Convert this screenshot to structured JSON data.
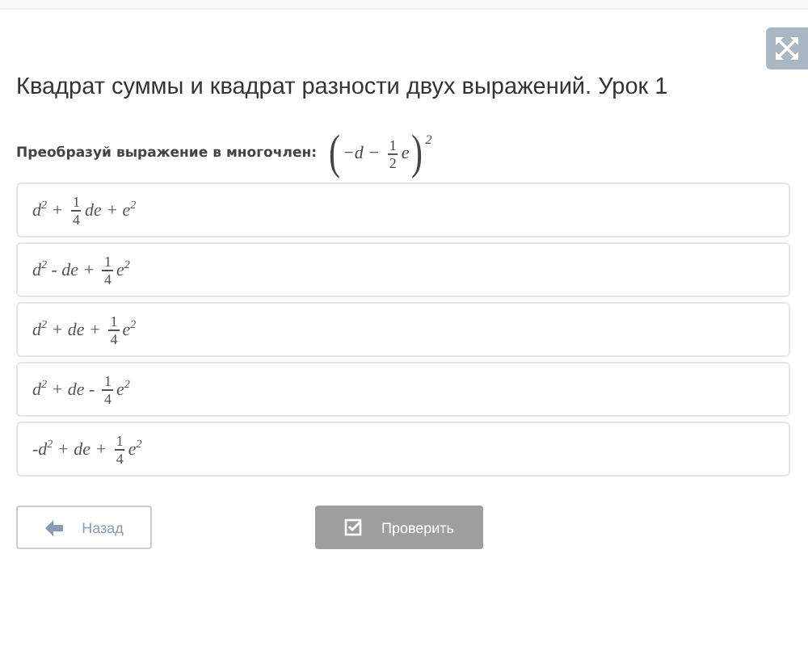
{
  "expand_button": {
    "kind": "expand"
  },
  "title": "Квадрат суммы и квадрат разности двух выражений. Урок 1",
  "question": {
    "label": "Преобразуй выражение в многочлен:",
    "expression": [
      {
        "kind": "paren",
        "t": "("
      },
      {
        "kind": "text",
        "t": "−d − "
      },
      {
        "kind": "frac",
        "num": "1",
        "den": "2"
      },
      {
        "kind": "text",
        "t": "e"
      },
      {
        "kind": "paren",
        "t": ")"
      },
      {
        "kind": "sup",
        "t": "2"
      }
    ]
  },
  "options": [
    {
      "selected": false,
      "parts": [
        {
          "kind": "text",
          "t": "d$^{2}$ + "
        },
        {
          "kind": "frac",
          "num": "1",
          "den": "4"
        },
        {
          "kind": "text",
          "t": "de + e$^{2}$"
        }
      ]
    },
    {
      "selected": false,
      "parts": [
        {
          "kind": "text",
          "t": "d$^{2}$ - de + "
        },
        {
          "kind": "frac",
          "num": "1",
          "den": "4"
        },
        {
          "kind": "text",
          "t": "e$^{2}$"
        }
      ]
    },
    {
      "selected": false,
      "parts": [
        {
          "kind": "text",
          "t": "d$^{2}$ + de + "
        },
        {
          "kind": "frac",
          "num": "1",
          "den": "4"
        },
        {
          "kind": "text",
          "t": "e$^{2}$"
        }
      ]
    },
    {
      "selected": false,
      "parts": [
        {
          "kind": "text",
          "t": "d$^{2}$ + de - "
        },
        {
          "kind": "frac",
          "num": "1",
          "den": "4"
        },
        {
          "kind": "text",
          "t": "e$^{2}$"
        }
      ]
    },
    {
      "selected": false,
      "parts": [
        {
          "kind": "text",
          "t": "-d$^{2}$ + de + "
        },
        {
          "kind": "frac",
          "num": "1",
          "den": "4"
        },
        {
          "kind": "text",
          "t": "e$^{2}$"
        }
      ]
    }
  ],
  "buttons": [
    {
      "kind": "back",
      "label": "Назад",
      "disabled": false
    },
    {
      "kind": "check",
      "label": "Проверить",
      "disabled": true
    }
  ]
}
